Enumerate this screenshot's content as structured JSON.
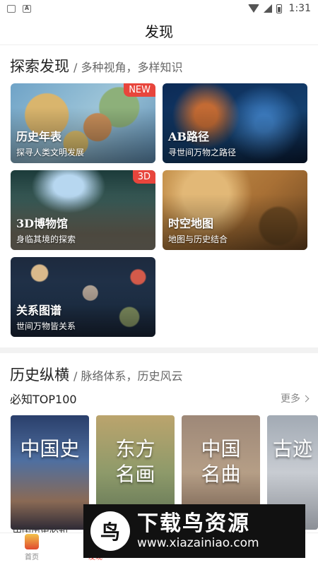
{
  "status_bar": {
    "time": "1:31",
    "icons": [
      "image-icon",
      "text-a-icon",
      "wifi-icon",
      "signal-icon",
      "battery-icon"
    ]
  },
  "header": {
    "title": "发现"
  },
  "explore": {
    "title": "探索发现",
    "subtitle": "/ 多种视角，多样知识",
    "cards": [
      {
        "title": "历史年表",
        "subtitle": "探寻人类文明发展",
        "badge": "NEW"
      },
      {
        "title": "AB路径",
        "subtitle": "寻世间万物之路径",
        "badge": ""
      },
      {
        "title": "3D博物馆",
        "subtitle": "身临其境的探索",
        "badge": "3D"
      },
      {
        "title": "时空地图",
        "subtitle": "地图与历史结合",
        "badge": ""
      },
      {
        "title": "关系图谱",
        "subtitle": "世间万物皆关系",
        "badge": ""
      }
    ]
  },
  "history": {
    "title": "历史纵横",
    "subtitle": "/ 脉络体系，历史风云",
    "top_label": "必知TOP100",
    "more_label": "更多",
    "books": [
      {
        "title_line1": "中国史",
        "title_line2": "",
        "caption": "中国历史必知"
      },
      {
        "title_line1": "东方",
        "title_line2": "名画",
        "caption": ""
      },
      {
        "title_line1": "中国",
        "title_line2": "名曲",
        "caption": ""
      },
      {
        "title_line1": "古迹",
        "title_line2": "",
        "caption": ""
      }
    ]
  },
  "tabbar": {
    "tabs": [
      {
        "label": "首页",
        "active": false
      },
      {
        "label": "发现",
        "active": true
      },
      {
        "label": "",
        "active": false
      },
      {
        "label": "",
        "active": false
      },
      {
        "label": "",
        "active": false
      }
    ]
  },
  "watermark": {
    "logo_glyph": "鸟",
    "title": "下载鸟资源",
    "url": "www.xiazainiao.com"
  },
  "colors": {
    "accent": "#e8453c",
    "divider": "#f2f2f2"
  }
}
